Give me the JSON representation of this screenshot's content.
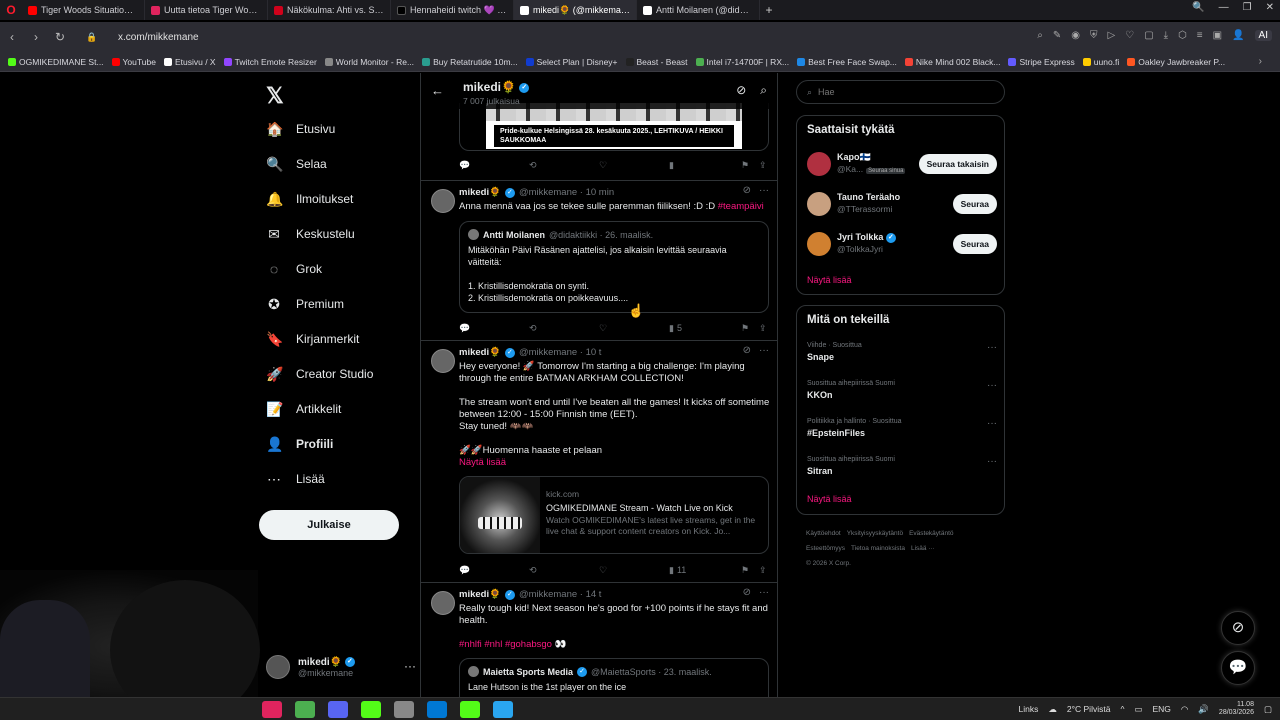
{
  "browser": {
    "tabs": [
      {
        "label": "Tiger Woods Situation - Yo",
        "color": "#ff0000"
      },
      {
        "label": "Uutta tietoa Tiger Woodsi",
        "color": "#e0245e"
      },
      {
        "label": "Näkökulma: Ahti vs. Sann",
        "color": "#d0021b"
      },
      {
        "label": "Hennaheidi twitch 💜 (@",
        "color": "#000000"
      },
      {
        "label": "mikedi🌻 (@mikkemane",
        "color": "#ffffff"
      },
      {
        "label": "Antti Moilanen (@didakti",
        "color": "#ffffff"
      }
    ],
    "url": "x.com/mikkemane",
    "ai_label": "AI",
    "bookmarks": [
      {
        "label": "OGMIKEDIMANE St...",
        "color": "#53fc18"
      },
      {
        "label": "YouTube",
        "color": "#ff0000"
      },
      {
        "label": "Etusivu / X",
        "color": "#ffffff"
      },
      {
        "label": "Twitch Emote Resizer",
        "color": "#9146ff"
      },
      {
        "label": "World Monitor - Re...",
        "color": "#888888"
      },
      {
        "label": "Buy Retatrutide 10m...",
        "color": "#2a9d8f"
      },
      {
        "label": "Select Plan | Disney+",
        "color": "#113ccf"
      },
      {
        "label": "Beast - Beast",
        "color": "#222222"
      },
      {
        "label": "Intel i7-14700F | RX...",
        "color": "#4caf50"
      },
      {
        "label": "Best Free Face Swap...",
        "color": "#1e88e5"
      },
      {
        "label": "Nike Mind 002 Black...",
        "color": "#f44336"
      },
      {
        "label": "Stripe Express",
        "color": "#635bff"
      },
      {
        "label": "uuno.fi",
        "color": "#ffcc00"
      },
      {
        "label": "Oakley Jawbreaker P...",
        "color": "#ff5722"
      }
    ]
  },
  "nav": {
    "items": [
      {
        "label": "Etusivu",
        "icon": "🏠"
      },
      {
        "label": "Selaa",
        "icon": "🔍"
      },
      {
        "label": "Ilmoitukset",
        "icon": "🔔"
      },
      {
        "label": "Keskustelu",
        "icon": "✉"
      },
      {
        "label": "Grok",
        "icon": "◌"
      },
      {
        "label": "Premium",
        "icon": "✪"
      },
      {
        "label": "Kirjanmerkit",
        "icon": "🔖"
      },
      {
        "label": "Creator Studio",
        "icon": "🚀"
      },
      {
        "label": "Artikkelit",
        "icon": "📝"
      },
      {
        "label": "Profiili",
        "icon": "👤"
      },
      {
        "label": "Lisää",
        "icon": "⋯"
      }
    ],
    "post_label": "Julkaise",
    "profile_name": "mikedi🌻",
    "profile_handle": "@mikkemane"
  },
  "feed": {
    "header_name": "mikedi🌻",
    "header_count": "7 007 julkaisua",
    "photo_caption": "Pride-kulkue Helsingissä 28. kesäkuuta 2025., LEHTIKUVA / HEIKKI SAUKKOMAA",
    "tweets": [
      {
        "name": "mikedi🌻",
        "handle": "@mikkemane · 10 min",
        "text": "Anna mennä vaa jos se tekee sulle paremman fiiliksen! :D :D",
        "hashtag": "#teampäivi",
        "quote_name": "Antti Moilanen",
        "quote_handle": "@didaktiikki · 26. maalisk.",
        "quote_text": "Mitäköhän Päivi Räsänen ajattelisi, jos alkaisin levittää seuraavia väitteitä:\n\n1. Kristillisdemokratia on synti.\n2. Kristillisdemokratia on poikkeavuus....",
        "views": "5"
      },
      {
        "name": "mikedi🌻",
        "handle": "@mikkemane · 10 t",
        "text": "Hey everyone! 🚀 Tomorrow I'm starting a big challenge: I'm playing through the entire BATMAN ARKHAM COLLECTION!\n\nThe stream won't end until I've beaten all the games!  It kicks off sometime between 12:00 - 15:00 Finnish time (EET).\nStay tuned! 🦇🦇\n\n🚀🚀Huomenna haaste et pelaan",
        "show_more": "Näytä lisää",
        "link_domain": "kick.com",
        "link_title": "OGMIKEDIMANE Stream - Watch Live on Kick",
        "link_desc": "Watch OGMIKEDIMANE's latest live streams, get in the live chat & support content creators on Kick. Jo...",
        "views": "11"
      },
      {
        "name": "mikedi🌻",
        "handle": "@mikkemane · 14 t",
        "text": "Really tough kid! Next season he's good for +100 points if he stays fit and health.",
        "hashtags": "#nhlfi #nhl #gohabsgo 👀",
        "quote_name": "Maietta Sports Media",
        "quote_handle": "@MaiettaSports · 23. maalisk.",
        "quote_text": "Lane Hutson is the 1st player on the ice"
      }
    ]
  },
  "right": {
    "search_placeholder": "Hae",
    "wtf_title": "Saattaisit tykätä",
    "wtf": [
      {
        "name": "Kapo🇫🇮",
        "handle": "@Ka...",
        "tag": "Seuraa sinua",
        "button": "Seuraa takaisin",
        "color": "#b03040"
      },
      {
        "name": "Tauno Teräaho",
        "handle": "@TTerassormi",
        "tag": "",
        "button": "Seuraa",
        "color": "#c8a080"
      },
      {
        "name": "Jyri Tolkka",
        "handle": "@TolkkaJyri",
        "tag": "",
        "button": "Seuraa",
        "color": "#d08030"
      }
    ],
    "show_more": "Näytä lisää",
    "trends_title": "Mitä on tekeillä",
    "trends": [
      {
        "context": "Viihde · Suosittua",
        "name": "Snape"
      },
      {
        "context": "Suosittua aihepiirissä Suomi",
        "name": "KKOn"
      },
      {
        "context": "Politiikka ja hallinto · Suosittua",
        "name": "#EpsteinFiles"
      },
      {
        "context": "Suosittua aihepiirissä Suomi",
        "name": "Sitran"
      }
    ],
    "footer": [
      "Käyttöehdot",
      "Yksityisyyskäytäntö",
      "Evästekäytäntö",
      "Esteettömyys",
      "Tietoa mainoksista",
      "Lisää ···",
      "© 2026 X Corp."
    ]
  },
  "taskbar": {
    "links_label": "Links",
    "weather": "2°C Pilvistä",
    "lang": "ENG",
    "time": "11.08",
    "date": "28/03/2026",
    "apps": [
      "#e0245e",
      "#4caf50",
      "#5865f2",
      "#53fc18",
      "#888888",
      "#0078d4",
      "#53fc18",
      "#2aa6f0"
    ]
  }
}
